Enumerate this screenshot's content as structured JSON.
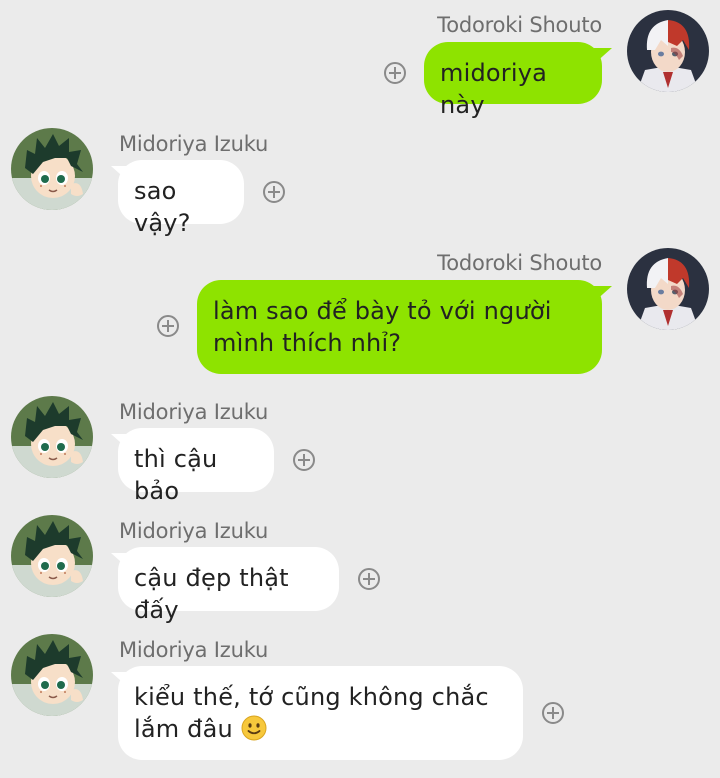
{
  "messages": [
    {
      "sender": "Todoroki Shouto",
      "text": "midoriya này",
      "direction": "outgoing"
    },
    {
      "sender": "Midoriya Izuku",
      "text": "sao vậy?",
      "direction": "incoming"
    },
    {
      "sender": "Todoroki Shouto",
      "text": "làm sao để bày tỏ với người\nmình thích nhỉ?",
      "direction": "outgoing"
    },
    {
      "sender": "Midoriya Izuku",
      "text": "thì cậu bảo",
      "direction": "incoming"
    },
    {
      "sender": "Midoriya Izuku",
      "text": "cậu đẹp thật đấy",
      "direction": "incoming"
    },
    {
      "sender": "Midoriya Izuku",
      "text": "kiểu thế, tớ cũng không chắc\nlắm đâu",
      "emoji": "slightly-smiling-face-emoji",
      "direction": "incoming"
    }
  ],
  "icons": {
    "react": "add-reaction-icon",
    "avatar_todoroki": "todoroki-avatar",
    "avatar_midoriya": "midoriya-avatar"
  },
  "colors": {
    "background": "#ebebeb",
    "outgoing_bubble": "#8ee300",
    "incoming_bubble": "#ffffff",
    "sender_text": "#6e6e6e"
  }
}
